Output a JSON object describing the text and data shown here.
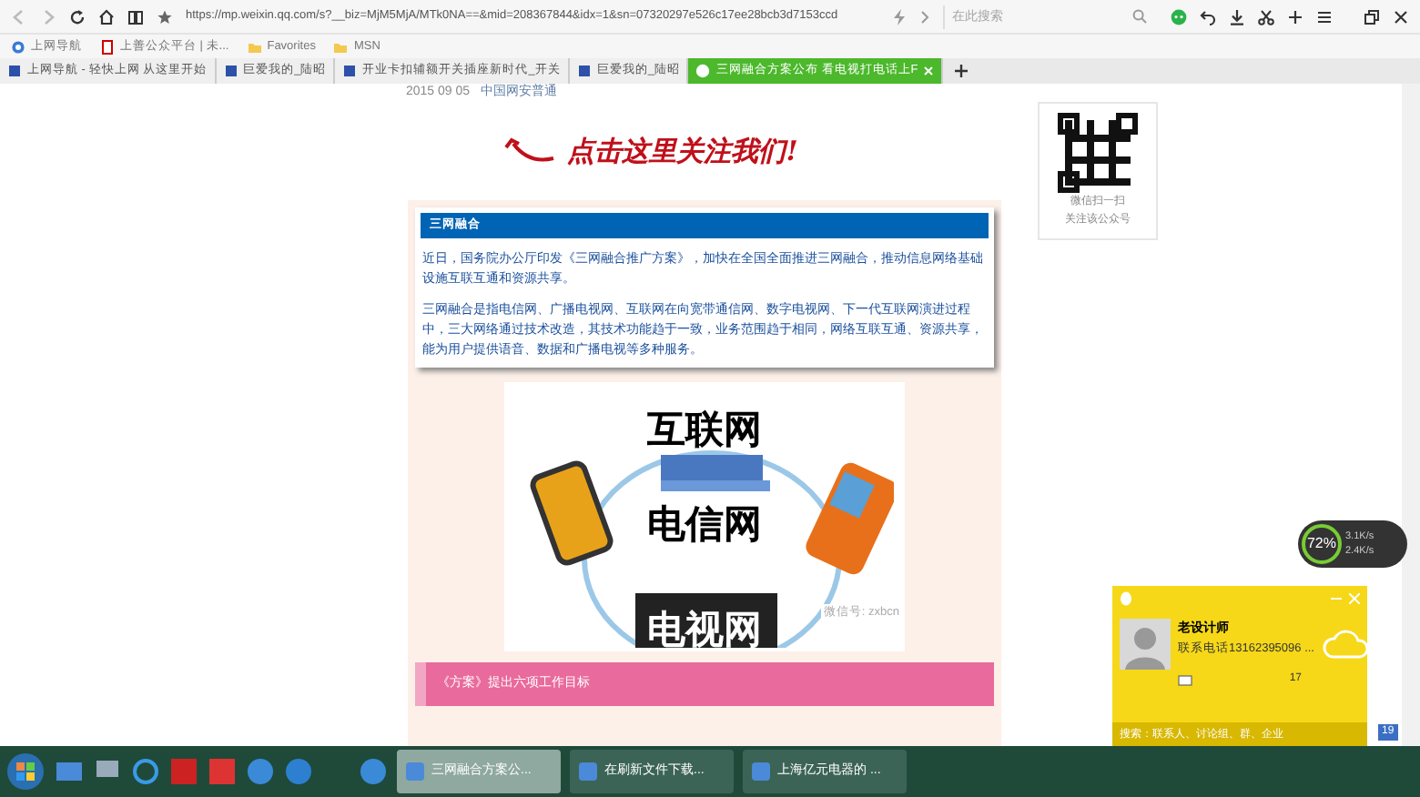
{
  "toolbar": {
    "url": "https://mp.weixin.qq.com/s?__biz=MjM5MjA/MTk0NA==&mid=208367844&idx=1&sn=07320297e526c17ee28bcb3d7153ccd",
    "search_placeholder": "在此搜索"
  },
  "bookmarks": [
    {
      "label": "上网导航",
      "kind": "site"
    },
    {
      "label": "上善公众平台 | 未...",
      "kind": "page"
    },
    {
      "label": "Favorites",
      "kind": "folder"
    },
    {
      "label": "MSN",
      "kind": "folder"
    }
  ],
  "tabs": [
    {
      "label": "上网导航 - 轻快上网 从这里开始",
      "selected": false
    },
    {
      "label": "巨爱我的_陆昭",
      "selected": false
    },
    {
      "label": "开业卡扣辅额开关插座新时代_开关",
      "selected": false
    },
    {
      "label": "巨爱我的_陆昭",
      "selected": false
    },
    {
      "label": "三网融合方案公布 看电视打电话上F",
      "selected": true
    }
  ],
  "article": {
    "date": "2015 09 05",
    "account": "中国网安普通",
    "follow_hint": "点击这里关注我们!",
    "qr_caption": [
      "微信扫一扫",
      "关注该公众号"
    ],
    "section_title": "三网融合",
    "paragraphs": [
      "近日，国务院办公厅印发《三网融合推广方案》，加快在全国全面推进三网融合，推动信息网络基础设施互联互通和资源共享。",
      "三网融合是指电信网、广播电视网、互联网在向宽带通信网、数字电视网、下一代互联网演进过程中，三大网络通过技术改造，其技术功能趋于一致，业务范围趋于相同，网络互联互通、资源共享，能为用户提供语音、数据和广播电视等多种服务。"
    ],
    "figure_labels": [
      "互联网",
      "电信网",
      "电视网"
    ],
    "figure_credit": "微信号: zxbcn",
    "subheading": "《方案》提出六项工作目标"
  },
  "speed_widget": {
    "percent": "72%",
    "upload": "3.1K/s",
    "download": "2.4K/s"
  },
  "qq_panel": {
    "name": "老设计师",
    "status": "联系电话13162395096 ...",
    "count": "17",
    "search_placeholder": "搜索：联系人、讨论组、群、企业",
    "second_count": "19"
  },
  "taskbar": [
    {
      "label": "三网融合方案公...",
      "selected": true
    },
    {
      "label": "在刷新文件下载...",
      "selected": false
    },
    {
      "label": "上海亿元电器的 ...",
      "selected": false
    }
  ]
}
